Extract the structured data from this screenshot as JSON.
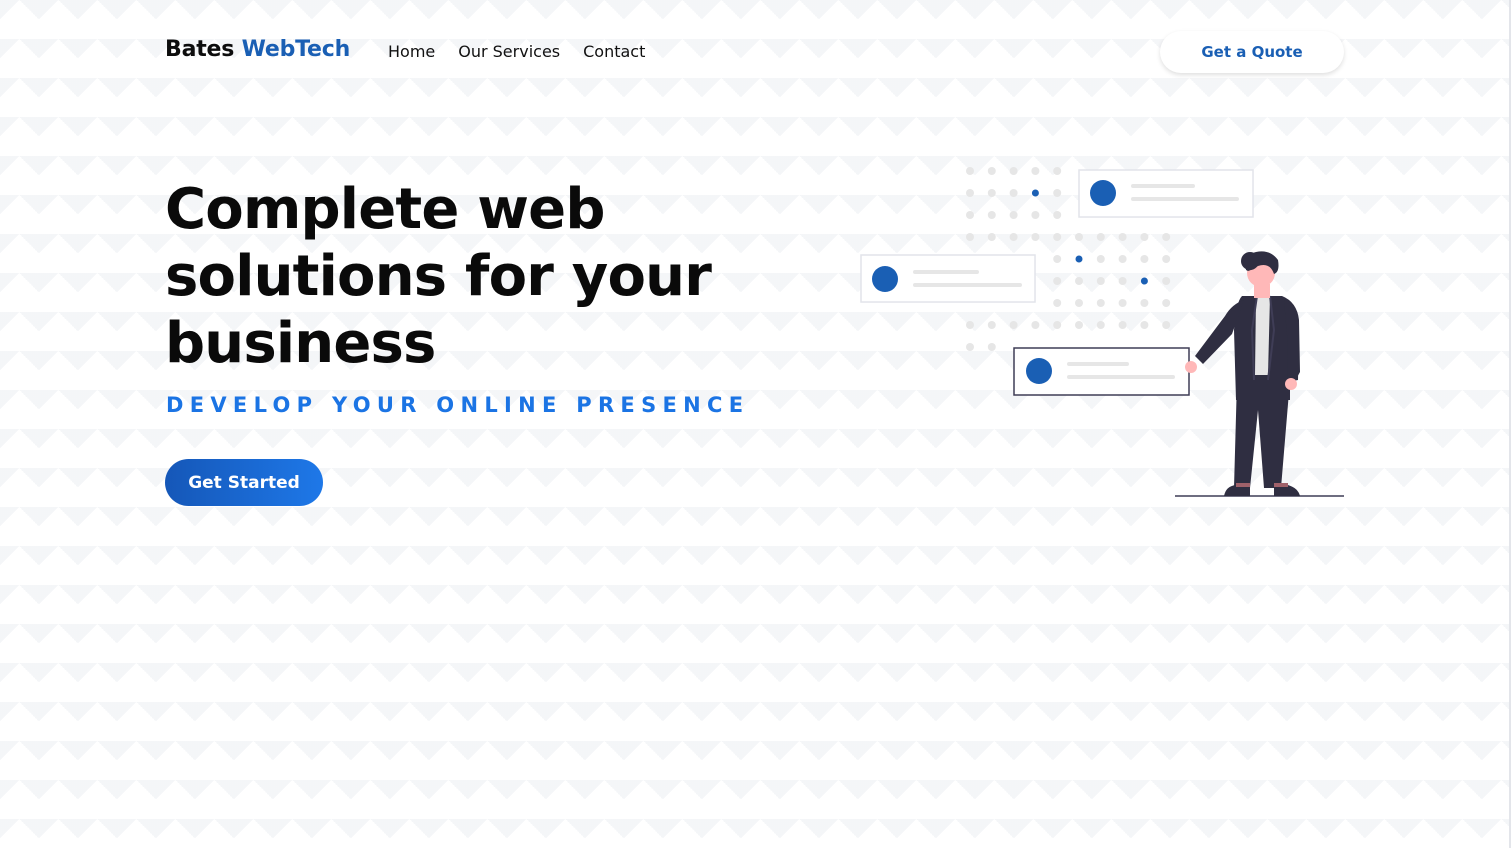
{
  "header": {
    "logo_part1": "Bates ",
    "logo_part2": "WebTech",
    "nav": [
      "Home",
      "Our Services",
      "Contact"
    ],
    "quote_button": "Get a Quote"
  },
  "hero": {
    "title": "Complete web solutions for your business",
    "subtitle": "DEVELOP YOUR ONLINE PRESENCE",
    "cta_button": "Get Started"
  },
  "illustration": {
    "name": "person-presenting-dashboard-cards-illustration"
  },
  "colors": {
    "brand_blue": "#1a5fb4",
    "accent_blue": "#1b74e4",
    "text_dark": "#0a0a0a",
    "figure_suit": "#2f2e41"
  }
}
